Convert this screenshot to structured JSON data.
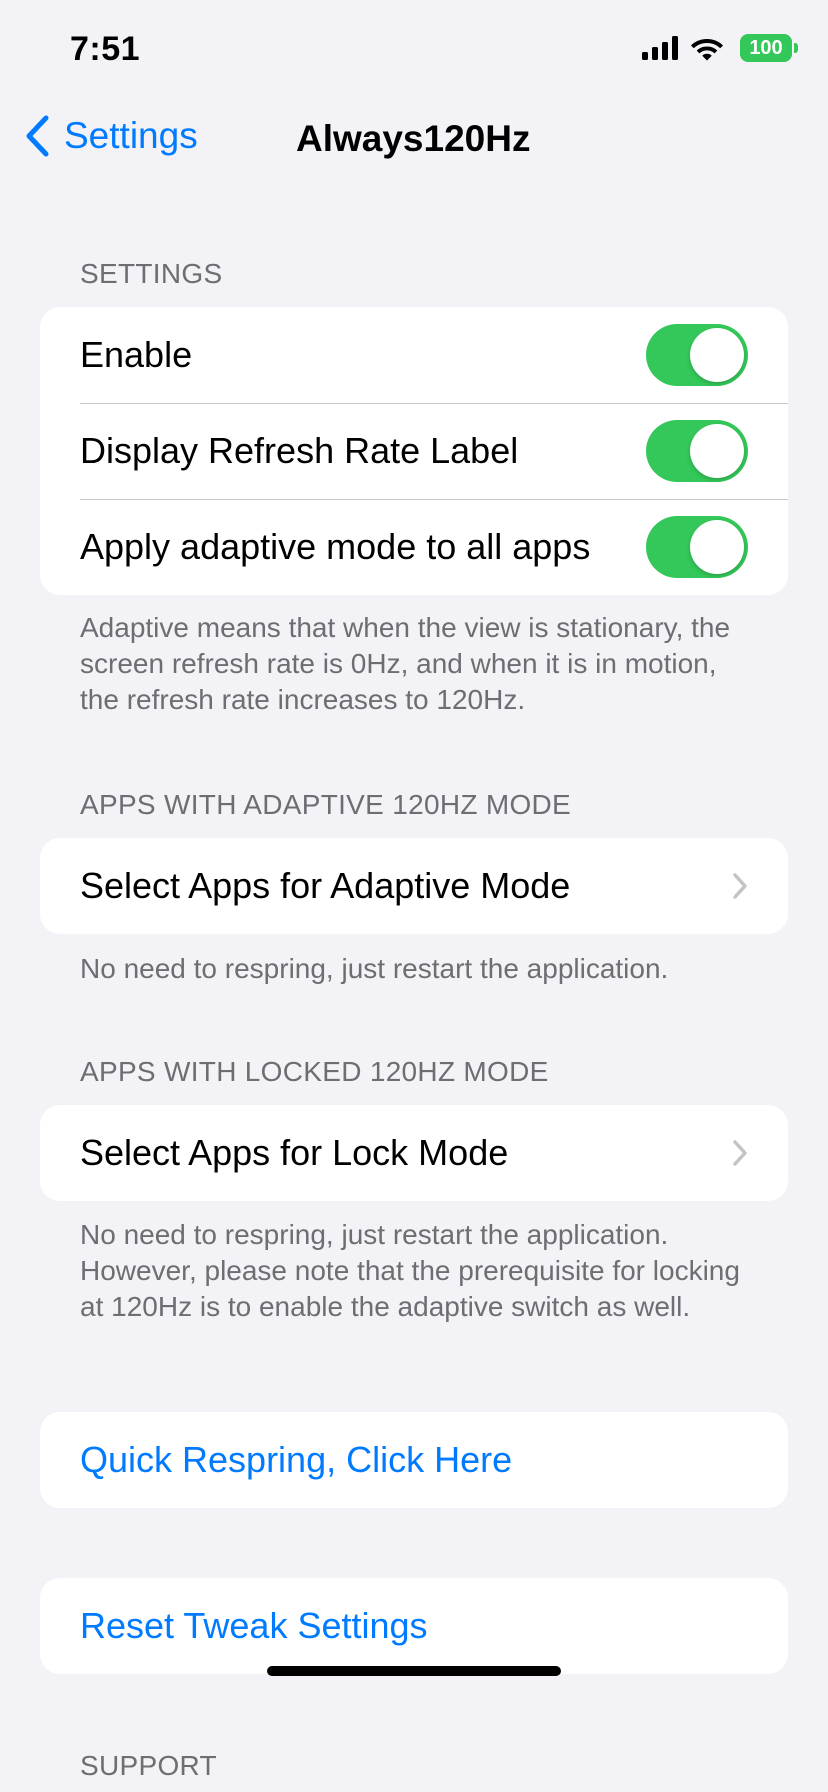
{
  "status_bar": {
    "time": "7:51",
    "battery_level": "100",
    "battery_color": "#34c759",
    "icons": [
      "signal-icon",
      "wifi-icon",
      "battery-icon"
    ]
  },
  "nav": {
    "back_label": "Settings",
    "title": "Always120Hz"
  },
  "colors": {
    "accent": "#007aff",
    "toggle_on": "#34c759",
    "background": "#f2f2f7",
    "secondary_text": "#6d6d72"
  },
  "settings_section": {
    "header": "SETTINGS",
    "rows": [
      {
        "label": "Enable",
        "toggle_on": true
      },
      {
        "label": "Display Refresh Rate Label",
        "toggle_on": true
      },
      {
        "label": "Apply adaptive mode to all apps",
        "toggle_on": true
      }
    ],
    "footer": "Adaptive means that when the view is stationary, the screen refresh rate is 0Hz, and when it is in motion, the refresh rate increases to 120Hz."
  },
  "adaptive_section": {
    "header": "APPS WITH ADAPTIVE 120HZ MODE",
    "row_label": "Select Apps for Adaptive Mode",
    "footer": "No need to respring, just restart the application."
  },
  "locked_section": {
    "header": "APPS WITH LOCKED 120HZ MODE",
    "row_label": "Select Apps for Lock Mode",
    "footer": "No need to respring, just restart the application. However, please note that the prerequisite for locking at 120Hz is to enable the adaptive switch as well."
  },
  "actions": {
    "respring_label": "Quick Respring, Click Here",
    "reset_label": "Reset Tweak Settings"
  },
  "support_section": {
    "header": "SUPPORT"
  }
}
